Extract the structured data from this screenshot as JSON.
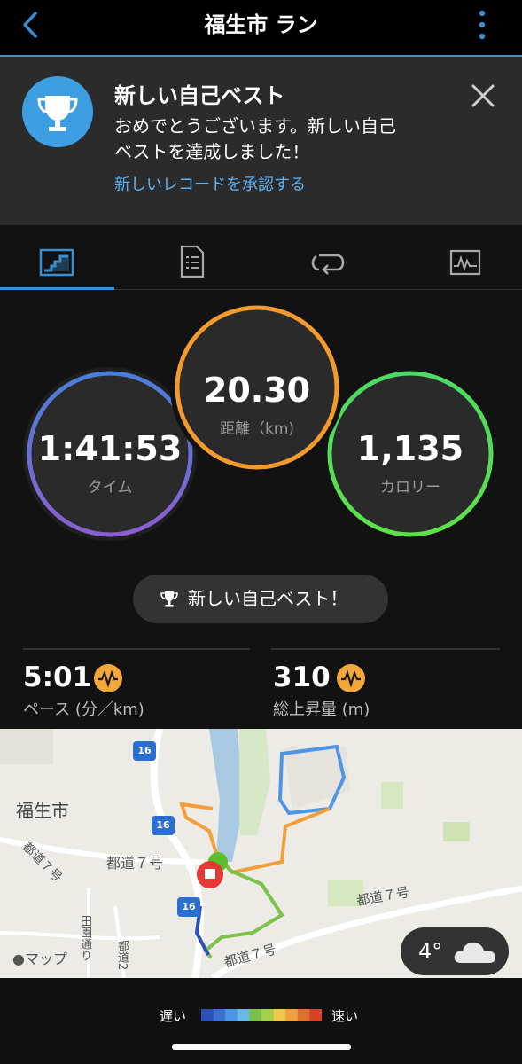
{
  "header": {
    "title": "福生市 ラン",
    "back_icon": "chevron-left-icon",
    "menu_icon": "kebab-menu-icon",
    "accent": "#3a8fd0"
  },
  "banner": {
    "title": "新しい自己ベスト",
    "body_line1": "おめでとうございます。新しい自己",
    "body_line2": "ベストを達成しました！",
    "link": "新しいレコードを承認する",
    "icon": "trophy-icon",
    "close_icon": "close-icon",
    "icon_color": "#3d9fe2",
    "link_color": "#5eb1f2"
  },
  "tabs": [
    {
      "name": "overview",
      "icon": "overview-chart-icon",
      "selected": true
    },
    {
      "name": "details",
      "icon": "document-icon",
      "selected": false
    },
    {
      "name": "laps",
      "icon": "laps-loop-icon",
      "selected": false
    },
    {
      "name": "charts",
      "icon": "activity-chart-icon",
      "selected": false
    }
  ],
  "stats": {
    "time": {
      "value": "1:41:53",
      "label": "タイム",
      "color": "#7f6fd6"
    },
    "distance": {
      "value": "20.30",
      "label": "距離（km)",
      "color": "#f29a2e"
    },
    "calories": {
      "value": "1,135",
      "label": "カロリー",
      "color": "#4cd964"
    }
  },
  "pr_button": {
    "label": "新しい自己ベスト！",
    "icon": "trophy-icon"
  },
  "metrics": [
    {
      "value": "5:01",
      "label": "ペース (分／km)",
      "icon": "wave-icon"
    },
    {
      "value": "310",
      "label": "総上昇量 (m)",
      "icon": "wave-icon"
    }
  ],
  "map": {
    "city_label": "福生市",
    "road_labels": [
      "都道７号",
      "都道７号",
      "都道７号",
      "都道７号"
    ],
    "road_vertical_1": "田園通り",
    "road_vertical_2": "都道2",
    "route_shields": [
      "16",
      "16",
      "16",
      "16"
    ],
    "attribution": "マップ",
    "weather_temp": "4°",
    "weather_icon": "cloud-icon"
  },
  "legend": {
    "slow": "遅い",
    "fast": "速い",
    "colors": [
      "#2a4fb8",
      "#3b6fd6",
      "#4f95e6",
      "#6ab8e8",
      "#7cc24a",
      "#a6d04a",
      "#f0c84a",
      "#f0a03a",
      "#e0702e",
      "#d9402a"
    ]
  }
}
